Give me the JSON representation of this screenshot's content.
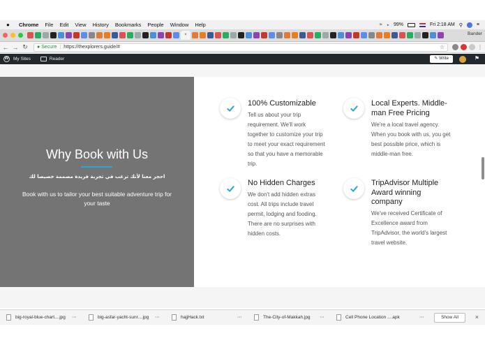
{
  "menubar": {
    "app": "Chrome",
    "items": [
      "File",
      "Edit",
      "View",
      "History",
      "Bookmarks",
      "People",
      "Window",
      "Help"
    ],
    "battery": "99%",
    "clock": "Fri 2:18 AM"
  },
  "browser": {
    "profile": "Bander",
    "active_tab_glyph": "×",
    "secure_label": "Secure",
    "url": "https://thexplorers.guide/#"
  },
  "wpbar": {
    "my_sites": "My Sites",
    "reader": "Reader",
    "write": "Write"
  },
  "hero": {
    "title": "Why Book with Us",
    "arabic": "احجز معنا لأنك ترغب في تجربة فريدة مصممة خصيصا لك",
    "description": "Book with us to tailor your best suitable adventure trip for your taste"
  },
  "features": [
    {
      "title": "100% Customizable",
      "lines": [
        "Tell us about your trip",
        "requirement. We'll work",
        "together to customize your trip",
        "to meet your exact requirement",
        "so that you have a memorable",
        "trip."
      ]
    },
    {
      "title_lines": [
        "Local Experts. Middle-",
        "man Free Pricing"
      ],
      "lines": [
        "We're a local travel agency.",
        "When you book with us, you get",
        "best possible price, which is",
        "middle-man free."
      ]
    },
    {
      "title": "No Hidden Charges",
      "lines": [
        "We don't add hidden extras",
        "cost. All trips include travel",
        "permit, lodging and fooding.",
        "There are no surprises with",
        "hidden costs."
      ]
    },
    {
      "title_lines": [
        "TripAdvisor Multiple",
        "Award winning",
        "company"
      ],
      "lines": [
        "We've received Certificate of",
        "Excellence award from",
        "TripAdvisor, the world's largest",
        "travel website."
      ]
    }
  ],
  "downloads": {
    "items": [
      "big-royal-blue-chart....jpg",
      "big-asfar-yacht-sunr....jpg",
      "hajjHack.txt",
      "The-City-of-Makkah.jpg",
      "Cell Phone Location ....apk"
    ],
    "show_all": "Show All"
  },
  "colors": {
    "accent": "#2aa7d8",
    "hero_bg": "#747474",
    "wp_bar": "#23282d"
  }
}
